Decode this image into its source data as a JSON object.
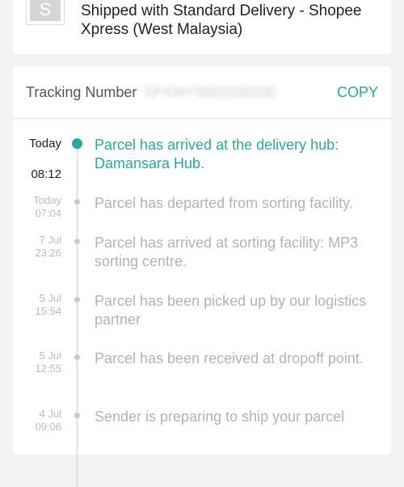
{
  "shipping": {
    "logo_letter": "S",
    "text": "Shipped with Standard Delivery - Shopee Xpress (West Malaysia)"
  },
  "tracking": {
    "label": "Tracking Number",
    "number_redacted": "SPXMY0000000000",
    "copy_label": "COPY"
  },
  "colors": {
    "accent": "#26aa99",
    "inactive_text": "#b3b3b3",
    "time_text": "#bcbcbc"
  },
  "events": [
    {
      "day": "Today",
      "time": "08:12",
      "text": "Parcel has arrived at the delivery hub: Damansara Hub."
    },
    {
      "day": "Today",
      "time": "07:04",
      "text": "Parcel has departed from sorting facility."
    },
    {
      "day": "7 Jul",
      "time": "23:26",
      "text": "Parcel has arrived at sorting facility: MP3 sorting centre."
    },
    {
      "day": "5 Jul",
      "time": "15:54",
      "text": "Parcel has been picked up by our logistics partner"
    },
    {
      "day": "5 Jul",
      "time": "12:55",
      "text": "Parcel has been received at dropoff point."
    },
    {
      "day": "4 Jul",
      "time": "09:06",
      "text": "Sender is preparing to ship your parcel"
    }
  ]
}
